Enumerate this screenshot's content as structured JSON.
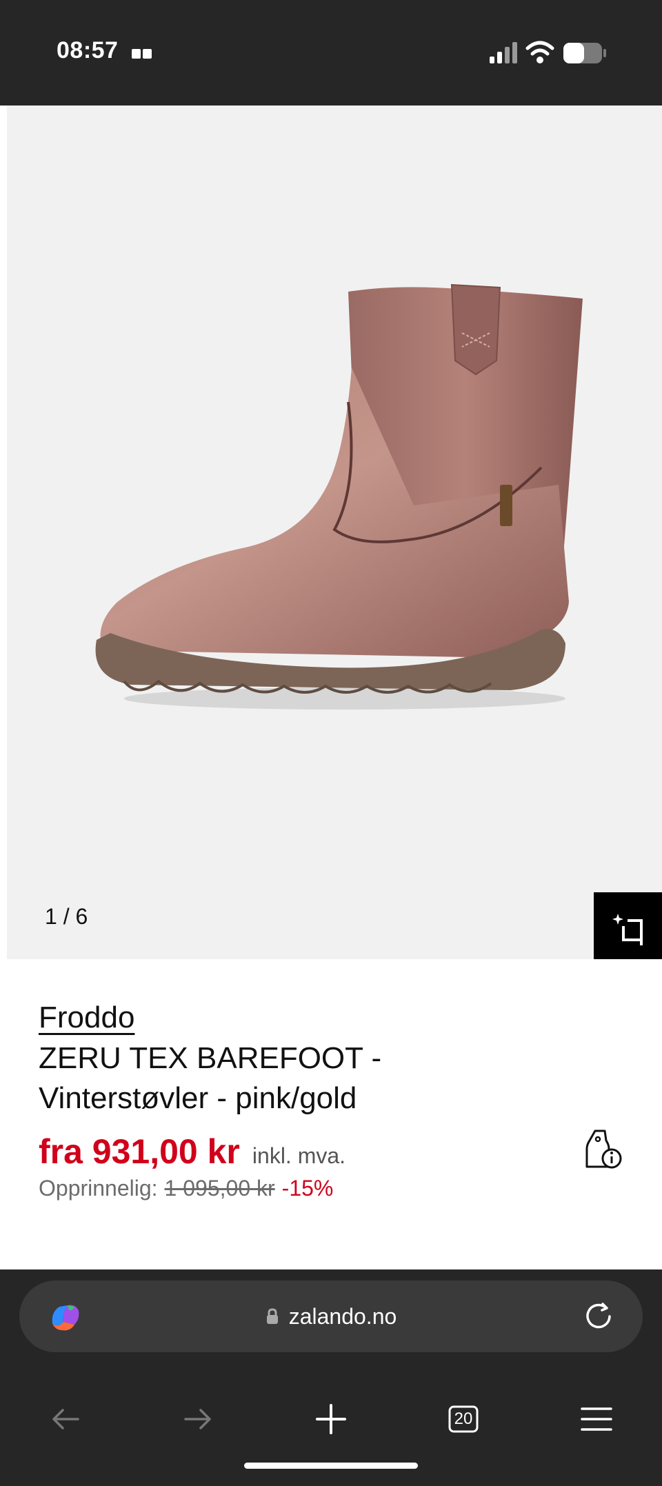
{
  "status_bar": {
    "time": "08:57",
    "icons": [
      "reader-icon",
      "signal-icon",
      "wifi-icon",
      "battery-icon"
    ]
  },
  "gallery": {
    "counter": "1 / 6",
    "image_alt": "pink metallic leather children's winter boot",
    "similar_button_icon": "find-similar-icon"
  },
  "product": {
    "brand": "Froddo",
    "title": "ZERU TEX BAREFOOT - Vinterstøvler - pink/gold",
    "price": "fra 931,00 kr",
    "price_vat": "inkl. mva.",
    "original_label": "Opprinnelig:",
    "original_price": "1 095,00 kr",
    "discount": "-15%",
    "price_info_icon": "price-tag-info-icon"
  },
  "browser": {
    "url": "zalando.no",
    "tabs_count": "20",
    "nav_icons": [
      "back-icon",
      "forward-icon",
      "new-tab-icon",
      "tabs-icon",
      "menu-icon"
    ]
  },
  "colors": {
    "price_red": "#d0021b",
    "dark_bar": "#262626",
    "gallery_bg": "#f1f1f1"
  }
}
